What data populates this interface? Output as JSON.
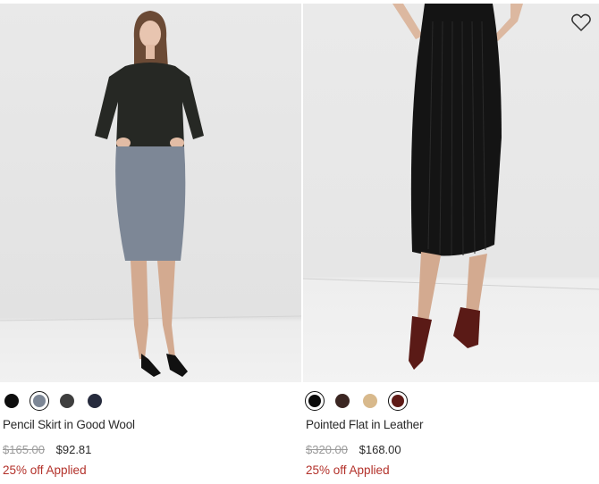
{
  "products": [
    {
      "name": "Pencil Skirt in Good Wool",
      "original_price": "$165.00",
      "sale_price": "$92.81",
      "promo": "25% off Applied",
      "swatches": [
        {
          "color": "#0d0d0d",
          "selected": false
        },
        {
          "color": "#7d8796",
          "selected": true
        },
        {
          "color": "#3e3e3e",
          "selected": false
        },
        {
          "color": "#262b3d",
          "selected": false
        }
      ]
    },
    {
      "name": "Pointed Flat in Leather",
      "original_price": "$320.00",
      "sale_price": "$168.00",
      "promo": "25% off Applied",
      "swatches": [
        {
          "color": "#0a0a0a",
          "selected": true
        },
        {
          "color": "#3b2622",
          "selected": false
        },
        {
          "color": "#d8b98c",
          "selected": false
        },
        {
          "color": "#5e1a16",
          "selected": true
        }
      ]
    }
  ],
  "wishlist_icon": "heart-outline-icon"
}
